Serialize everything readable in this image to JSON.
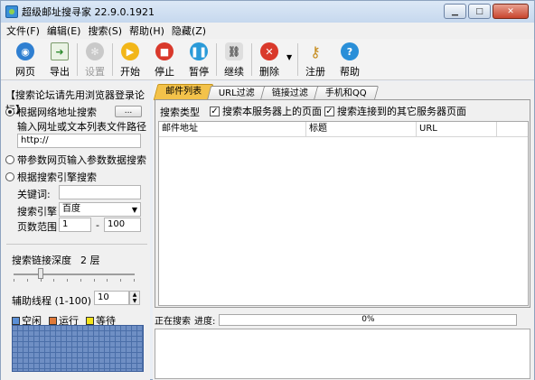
{
  "window": {
    "title": "超级邮址搜寻家 22.9.0.1921",
    "min": "▁",
    "max": "□",
    "close": "✕"
  },
  "menu": [
    "文件(F)",
    "编辑(E)",
    "搜索(S)",
    "帮助(H)",
    "隐藏(Z)"
  ],
  "toolbar": {
    "web": "网页",
    "export": "导出",
    "settings": "设置",
    "start": "开始",
    "stop": "停止",
    "pause": "暂停",
    "continue": "继续",
    "delete": "删除",
    "register": "注册",
    "help": "帮助"
  },
  "left": {
    "header": "【搜索论坛请先用浏览器登录论坛】",
    "mode_url": "根据网络地址搜索",
    "browse": "...",
    "url_label": "输入网址或文本列表文件路径",
    "url_value": "http://",
    "mode_params": "带参数网页输入参数数据搜索",
    "mode_engine": "根据搜索引擎搜索",
    "keyword_label": "关键词:",
    "keyword_value": "",
    "engine_label": "搜索引擎",
    "engine_value": "百度",
    "page_label": "页数范围",
    "page_from": "1",
    "page_dash": "-",
    "page_to": "100",
    "depth_label": "搜索链接深度",
    "depth_value": "2 层",
    "threads_label": "辅助线程 (1-100)",
    "threads_value": "10",
    "legend_idle": "空闲",
    "legend_running": "运行",
    "legend_waiting": "等待",
    "color_idle": "#5b8fd6",
    "color_running": "#e07a3a",
    "color_waiting": "#f2e31a"
  },
  "tabs": [
    "邮件列表",
    "URL过滤",
    "链接过滤",
    "手机和QQ"
  ],
  "panel": {
    "type_label": "搜索类型",
    "opt_local": "搜索本服务器上的页面",
    "opt_other": "搜索连接到的其它服务器页面",
    "columns": [
      "邮件地址",
      "标题",
      "URL"
    ]
  },
  "status": {
    "label": "正在搜索",
    "progress_label": "进度:",
    "progress_value": "0%"
  }
}
